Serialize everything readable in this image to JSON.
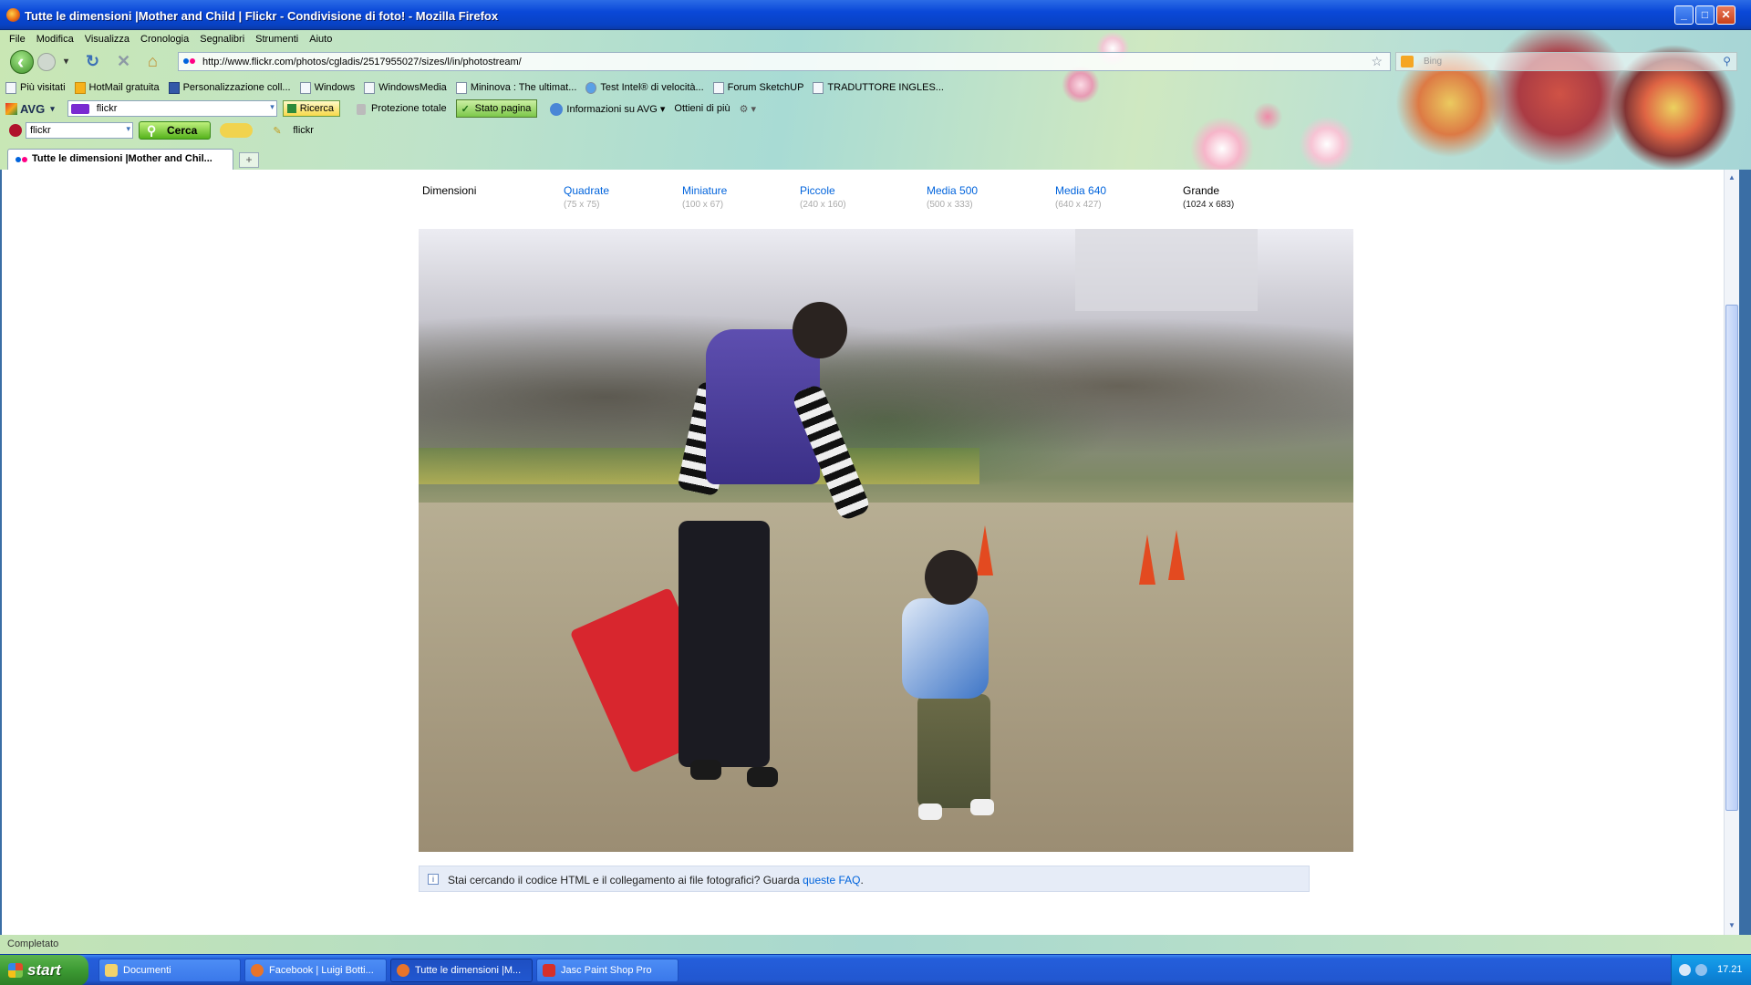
{
  "window": {
    "title": "Tutte le dimensioni |Mother and Child | Flickr - Condivisione di foto! - Mozilla Firefox"
  },
  "menubar": [
    "File",
    "Modifica",
    "Visualizza",
    "Cronologia",
    "Segnalibri",
    "Strumenti",
    "Aiuto"
  ],
  "navbar": {
    "url": "http://www.flickr.com/photos/cgladis/2517955027/sizes/l/in/photostream/",
    "search_placeholder": "Bing"
  },
  "bookmarks": [
    "Più visitati",
    "HotMail gratuita",
    "Personalizzazione coll...",
    "Windows",
    "WindowsMedia",
    "Mininova : The ultimat...",
    "Test Intel® di velocità...",
    "Forum SketchUP",
    "TRADUTTORE INGLES..."
  ],
  "avg_toolbar": {
    "logo": "AVG",
    "search_value": "flickr",
    "search_button": "Ricerca",
    "protection": "Protezione totale",
    "page_status": "Stato pagina",
    "info": "Informazioni su AVG",
    "more": "Ottieni di più"
  },
  "yahoo_toolbar": {
    "search_value": "flickr",
    "search_button": "Cerca",
    "flickr_label": "flickr"
  },
  "tabs": [
    {
      "label": "Tutte le dimensioni |Mother and Chil...",
      "active": true
    }
  ],
  "sizes": {
    "heading": "Dimensioni",
    "options": [
      {
        "name": "Quadrate",
        "dim": "(75 x 75)",
        "link": true
      },
      {
        "name": "Miniature",
        "dim": "(100 x 67)",
        "link": true
      },
      {
        "name": "Piccole",
        "dim": "(240 x 160)",
        "link": true
      },
      {
        "name": "Media 500",
        "dim": "(500 x 333)",
        "link": true
      },
      {
        "name": "Media 640",
        "dim": "(640 x 427)",
        "link": true
      },
      {
        "name": "Grande",
        "dim": "(1024 x 683)",
        "link": false
      }
    ]
  },
  "faq": {
    "text": "Stai cercando il codice HTML e il collegamento ai file fotografici? Guarda ",
    "link": "queste FAQ",
    "end": "."
  },
  "statusbar": {
    "text": "Completato"
  },
  "taskbar": {
    "start": "start",
    "tasks": [
      {
        "label": "Documenti",
        "active": false
      },
      {
        "label": "Facebook | Luigi Botti...",
        "active": false
      },
      {
        "label": "Tutte le dimensioni |M...",
        "active": true
      },
      {
        "label": "Jasc Paint Shop Pro",
        "active": false
      }
    ],
    "clock": "17.21"
  },
  "colors": {
    "link": "#0063dc",
    "xp_blue": "#245edb",
    "start_green": "#3c9a33"
  }
}
